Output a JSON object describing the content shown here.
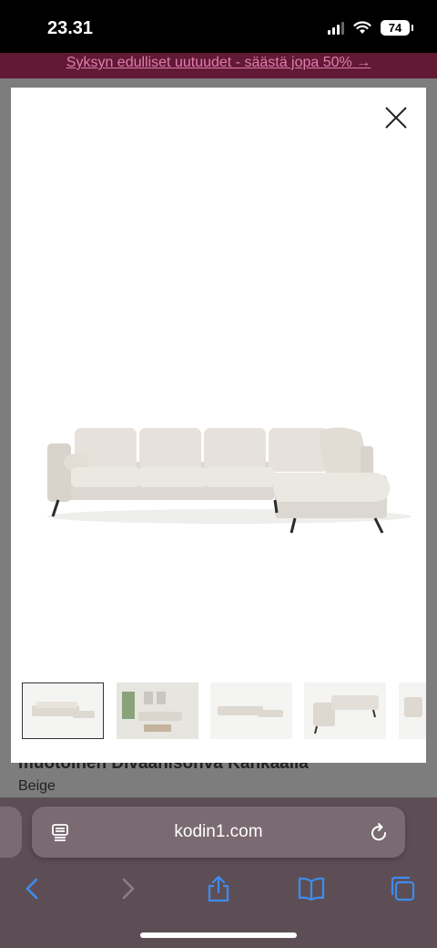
{
  "status": {
    "time": "23.31",
    "battery": "74"
  },
  "banner": {
    "text": "Syksyn edulliset uutuudet - säästä jopa 50% →"
  },
  "product": {
    "heading": "muotoinen Divaanisohva Kankaalla",
    "color": "Beige"
  },
  "gallery": {
    "thumbnails": [
      "sofa-front-view",
      "sofa-room-scene",
      "sofa-front-view-small",
      "sofa-corner-view",
      "sofa-partial-view"
    ],
    "selected_index": 0
  },
  "browser": {
    "url": "kodin1.com"
  },
  "colors": {
    "banner_bg": "#611935",
    "banner_text": "#e07db0",
    "safari_bar": "#5d4e55",
    "accent_blue": "#3d8cf0"
  },
  "icons": [
    "close-icon",
    "reader-icon",
    "reload-icon",
    "back-icon",
    "forward-icon",
    "share-icon",
    "bookmarks-icon",
    "tabs-icon"
  ]
}
